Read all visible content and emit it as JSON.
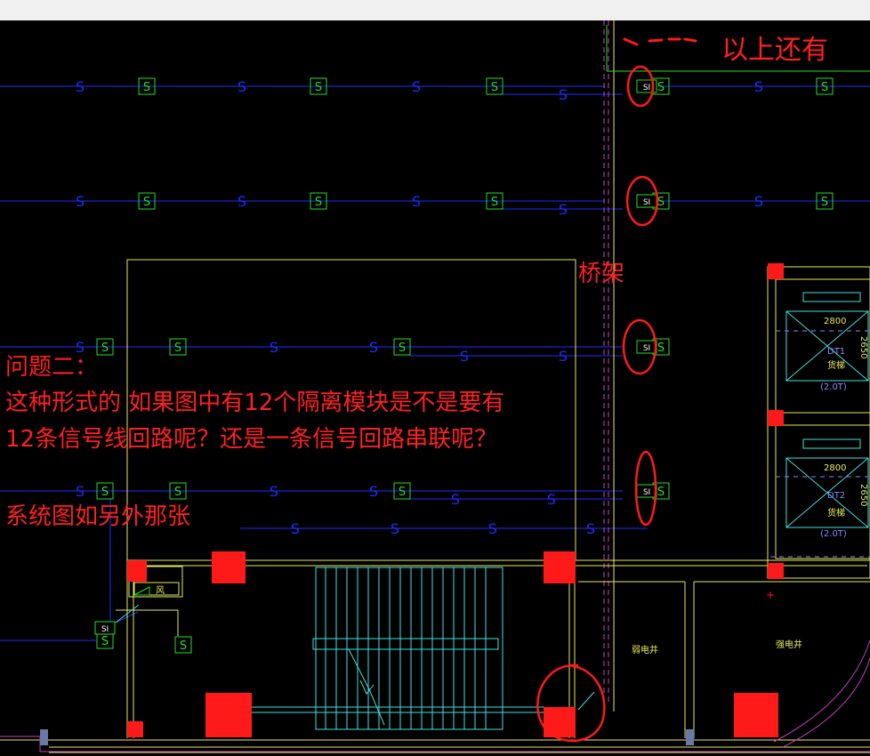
{
  "annotations": {
    "question_title": "问题二：",
    "question_line1": "这种形式的 如果图中有12个隔离模块是不是要有",
    "question_line2": "12条信号线回路呢？还是一条信号回路串联呢？",
    "system_note": "系统图如另外那张",
    "above_note": "以上还有",
    "tray_note": "桥架"
  },
  "cad": {
    "sensor_glyph": "S",
    "module_label": "SI",
    "elevator_code": "DT1",
    "elevator_code_2": "DT2",
    "elevator_type": "货梯",
    "elevator_load": "(2.0T)",
    "elevator_dim_w": "2800",
    "elevator_dim_h": "2650",
    "weak_shaft": "弱电井",
    "strong_shaft": "强电井",
    "fan_label": "风"
  },
  "colors": {
    "signal_line": "#1a2fff",
    "device_green": "#22e022",
    "wall_yellow": "#e8e860",
    "stair_cyan": "#44e0e0",
    "marker_red": "#ff1a1a",
    "annotation_red": "#ff2020",
    "tray_magenta": "#d040d0"
  }
}
